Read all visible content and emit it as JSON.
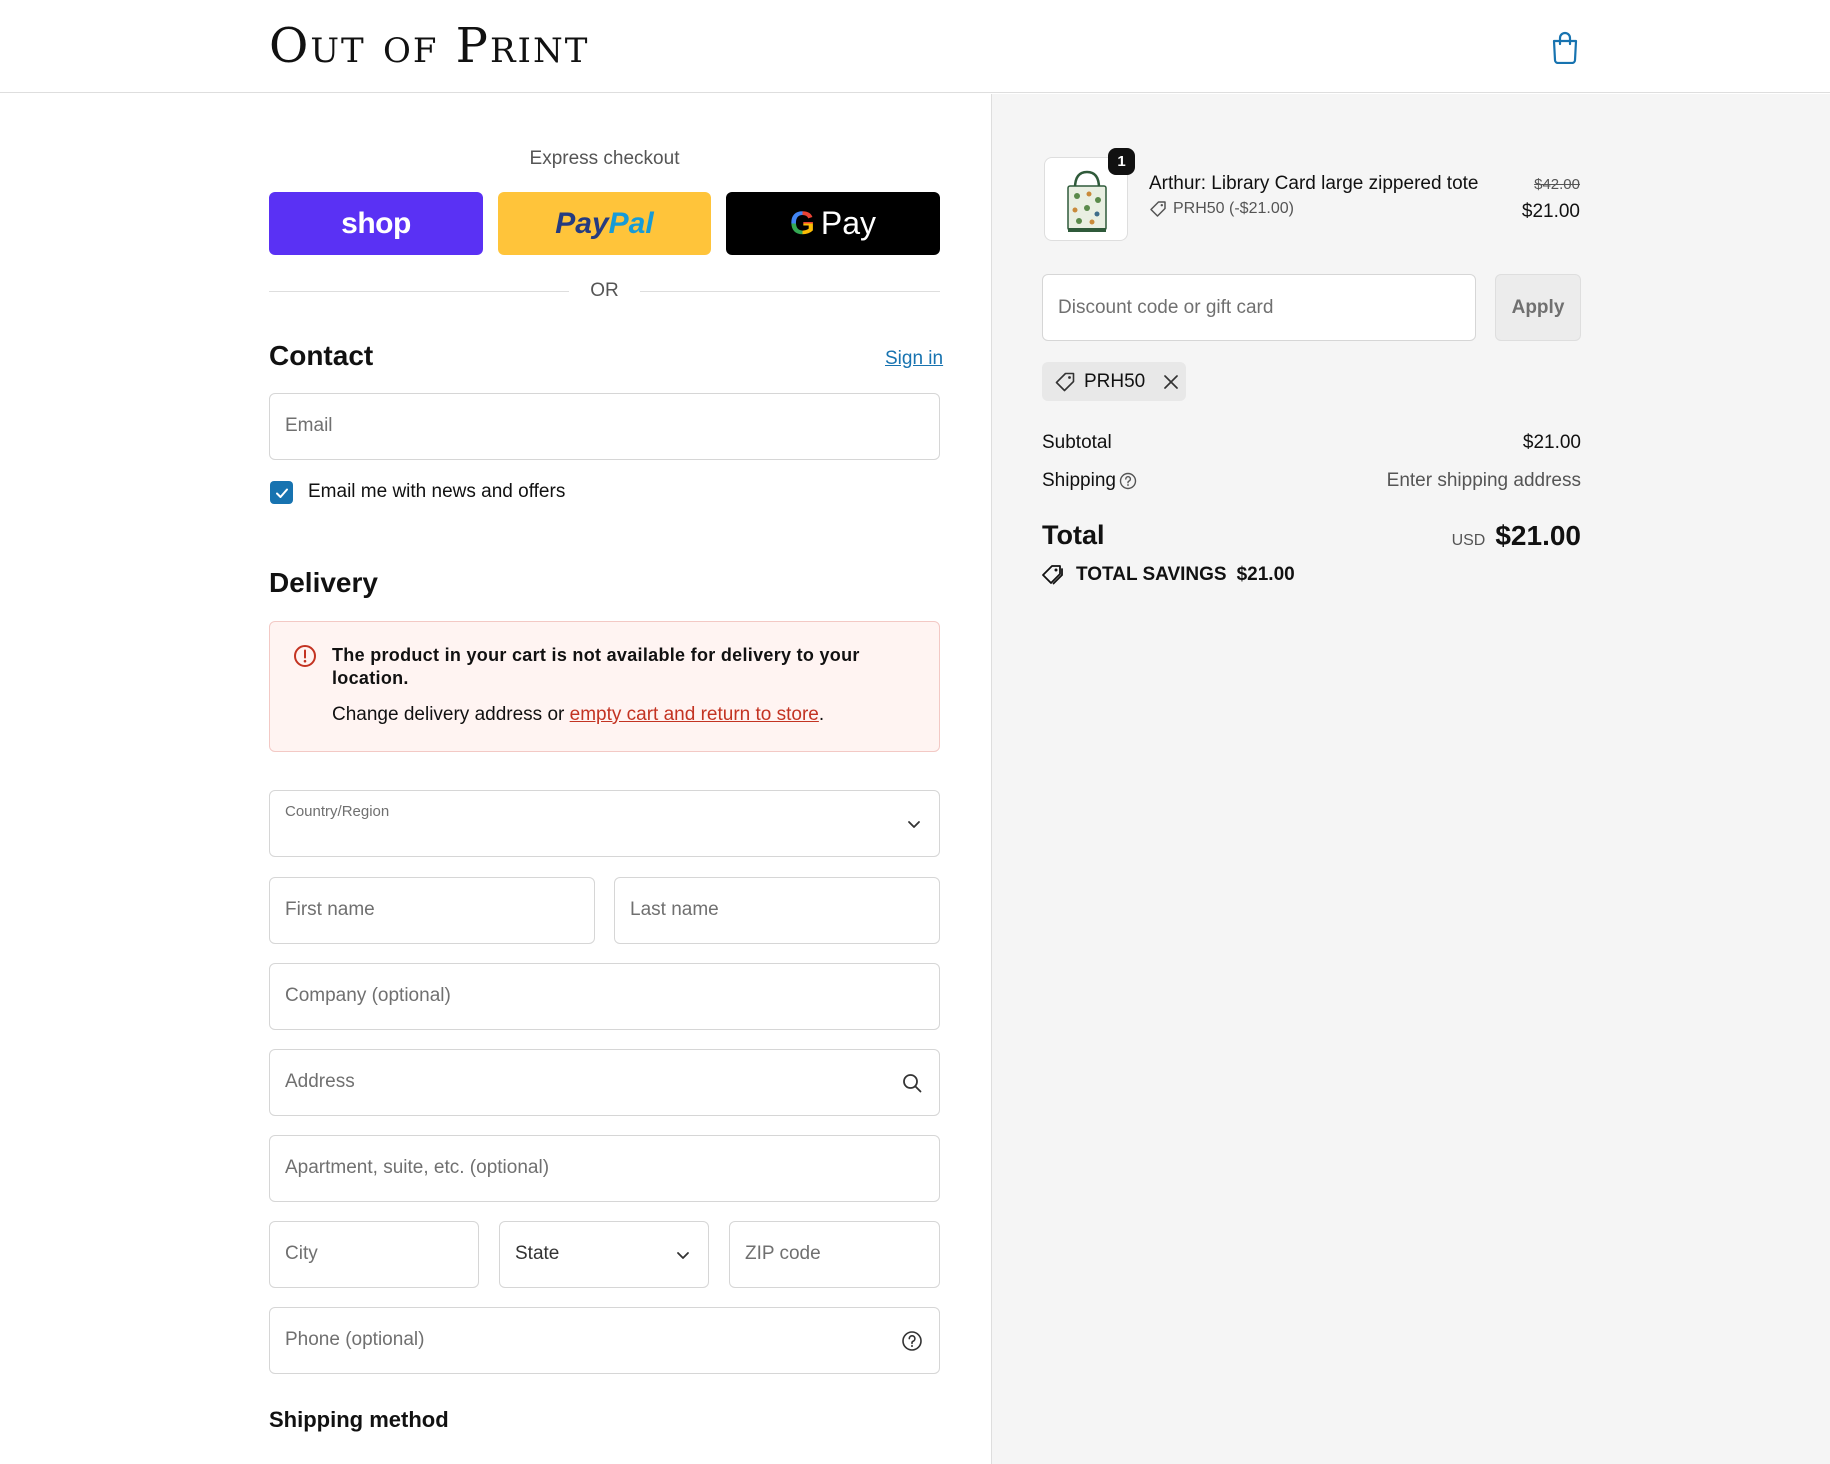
{
  "header": {
    "logo": "Out of Print",
    "cart_icon": "shopping-bag-icon"
  },
  "express": {
    "label": "Express checkout",
    "shop_label": "shop",
    "paypal_pay": "Pay",
    "paypal_pal": "Pal",
    "gpay_g": "G",
    "gpay_label": "Pay",
    "or": "OR"
  },
  "contact": {
    "title": "Contact",
    "sign_in": "Sign in",
    "email_placeholder": "Email",
    "newsletter_label": "Email me with news and offers",
    "newsletter_checked": true
  },
  "delivery": {
    "title": "Delivery",
    "alert_title": "The product in your cart is not available for delivery to your location.",
    "alert_body_prefix": "Change delivery address or ",
    "alert_link": "empty cart and return to store",
    "alert_body_suffix": ".",
    "country_label": "Country/Region",
    "first_name": "First name",
    "last_name": "Last name",
    "company": "Company (optional)",
    "address": "Address",
    "apartment": "Apartment, suite, etc. (optional)",
    "city": "City",
    "state": "State",
    "zip": "ZIP code",
    "phone": "Phone (optional)"
  },
  "shipping_method": {
    "title": "Shipping method"
  },
  "order": {
    "quantity": "1",
    "product_name": "Arthur: Library Card large zippered tote",
    "product_discount": "PRH50 (-$21.00)",
    "old_price": "$42.00",
    "new_price": "$21.00",
    "discount_placeholder": "Discount code or gift card",
    "apply": "Apply",
    "applied_code": "PRH50",
    "subtotal_label": "Subtotal",
    "subtotal_value": "$21.00",
    "shipping_label": "Shipping",
    "shipping_value": "Enter shipping address",
    "total_label": "Total",
    "currency": "USD",
    "total_value": "$21.00",
    "savings_label": "TOTAL SAVINGS",
    "savings_value": "$21.00"
  },
  "colors": {
    "shop": "#5a31f4",
    "paypal": "#ffc43a",
    "accent": "#1773b0",
    "error": "#c33322"
  }
}
